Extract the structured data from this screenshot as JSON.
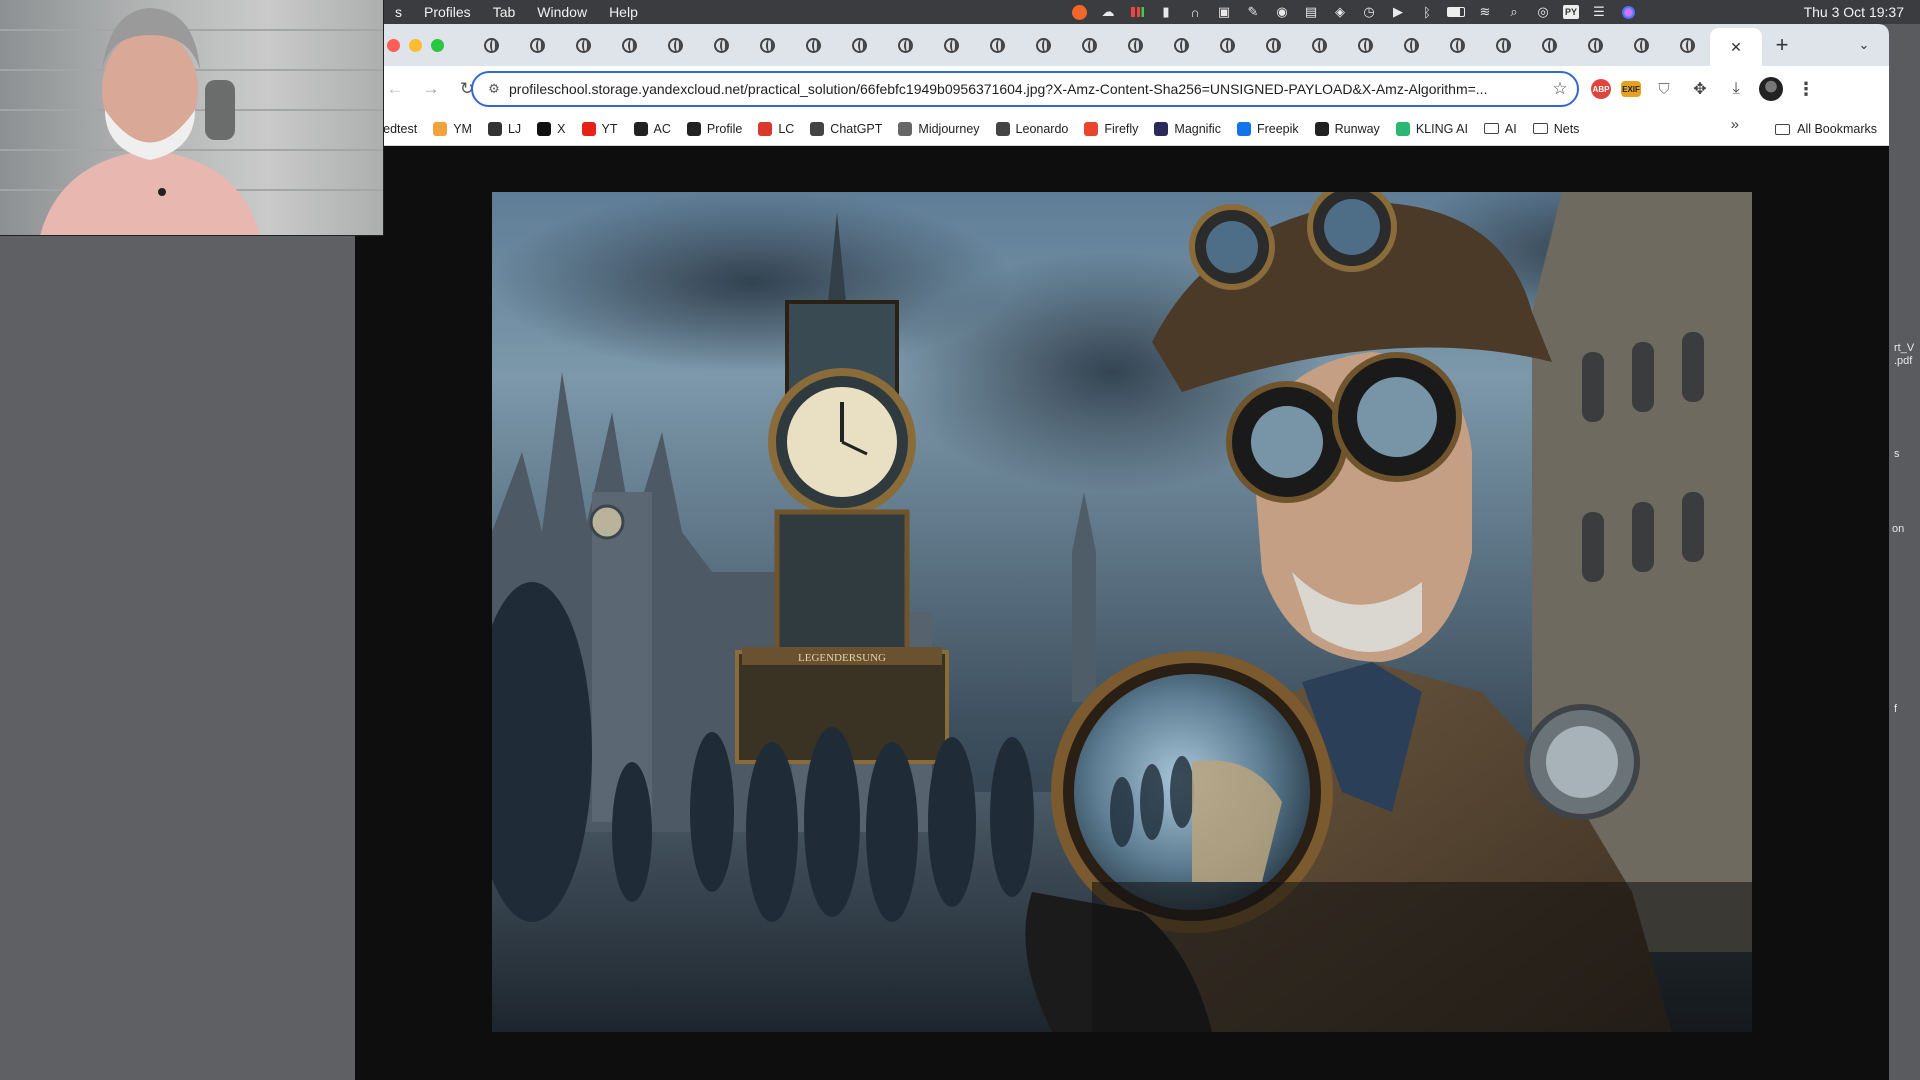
{
  "menubar": {
    "app_menu_fragment": "s",
    "items": [
      "Profiles",
      "Tab",
      "Window",
      "Help"
    ],
    "clock": "Thu 3 Oct  19:37",
    "status_icons": [
      "brave-icon",
      "creative-cloud-icon",
      "activity-icon",
      "waveform-icon",
      "headphones-icon",
      "notification-icon",
      "pen-icon",
      "sync-icon",
      "display-icon",
      "compass-icon",
      "time-machine-icon",
      "play-icon",
      "bluetooth-icon",
      "battery-icon",
      "wifi-icon",
      "search-icon",
      "user-icon",
      "py-icon",
      "control-center-icon",
      "siri-icon"
    ]
  },
  "browser": {
    "tab_count_inactive": 27,
    "active_tab_close": "✕",
    "new_tab": "+",
    "url": "profileschool.storage.yandexcloud.net/practical_solution/66febfc1949b0956371604.jpg?X-Amz-Content-Sha256=UNSIGNED-PAYLOAD&X-Amz-Algorithm=...",
    "extensions": {
      "abp_label": "ABP",
      "exif_label": "EXIF"
    },
    "bookmarks": [
      {
        "label": "speedtest",
        "icon": "speedtest-icon",
        "color": "#ffffff"
      },
      {
        "label": "YM",
        "icon": "mail-icon",
        "color": "#f2a23a"
      },
      {
        "label": "LJ",
        "icon": "livejournal-icon",
        "color": "#333333"
      },
      {
        "label": "X",
        "icon": "x-icon",
        "color": "#111111"
      },
      {
        "label": "YT",
        "icon": "youtube-icon",
        "color": "#e62117"
      },
      {
        "label": "AC",
        "icon": "ac-icon",
        "color": "#222222"
      },
      {
        "label": "Profile",
        "icon": "profile-icon",
        "color": "#222222"
      },
      {
        "label": "LC",
        "icon": "lc-icon",
        "color": "#d9392b"
      },
      {
        "label": "ChatGPT",
        "icon": "chatgpt-icon",
        "color": "#444444"
      },
      {
        "label": "Midjourney",
        "icon": "midjourney-icon",
        "color": "#666666"
      },
      {
        "label": "Leonardo",
        "icon": "leonardo-icon",
        "color": "#444444"
      },
      {
        "label": "Firefly",
        "icon": "firefly-icon",
        "color": "#e8452c"
      },
      {
        "label": "Magnific",
        "icon": "magnific-icon",
        "color": "#2a2a5a"
      },
      {
        "label": "Freepik",
        "icon": "freepik-icon",
        "color": "#1273eb"
      },
      {
        "label": "Runway",
        "icon": "runway-icon",
        "color": "#222222"
      },
      {
        "label": "KLING AI",
        "icon": "kling-icon",
        "color": "#2bb673"
      },
      {
        "label": "AI",
        "icon": "folder-icon",
        "color": "#444444"
      },
      {
        "label": "Nets",
        "icon": "folder-icon",
        "color": "#444444"
      }
    ],
    "bookmarks_overflow": "»",
    "all_bookmarks": "All Bookmarks"
  },
  "desktop_labels": [
    {
      "text": "rt_V\n.pdf"
    },
    {
      "text": "s"
    },
    {
      "text": "on"
    },
    {
      "text": "f"
    }
  ],
  "artwork_overlay_text": "LEGENDERSUNG",
  "colors": {
    "menubar_bg": "#3b3c40",
    "tabstrip_bg": "#dfe3ea",
    "omnibox_border": "#3367d6",
    "page_bg": "#0e0e0f"
  }
}
